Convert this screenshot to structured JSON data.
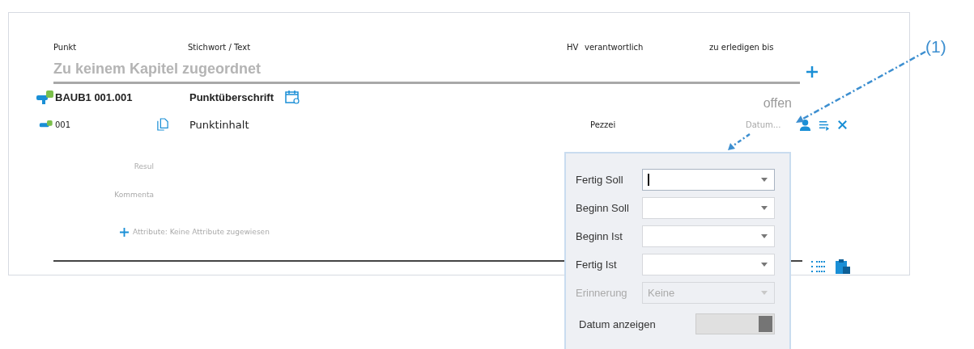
{
  "columns": [
    "Punkt",
    "Stichwort / Text",
    "HV",
    "verantwortlich",
    "zu erledigen bis"
  ],
  "chapter": "Zu keinem Kapitel zugeordnet",
  "point": {
    "number": "BAUB1 001.001",
    "heading": "Punktüberschrift",
    "status": "offen"
  },
  "subpoint": {
    "number": "001",
    "content": "Punktinhalt",
    "responsible": "Pezzei",
    "date": "Datum..."
  },
  "fields": [
    {
      "label": "Resul"
    },
    {
      "label": "Kommenta"
    }
  ],
  "attributes": "Attribute:  Keine Attribute zugewiesen",
  "date_popup": {
    "fields": [
      {
        "label": "Fertig Soll",
        "focused": true,
        "disabled": false
      },
      {
        "label": "Beginn Soll",
        "focused": false,
        "disabled": false
      },
      {
        "label": "Beginn Ist",
        "focused": false,
        "disabled": false
      },
      {
        "label": "Fertig Ist",
        "focused": false,
        "disabled": false
      },
      {
        "label": "Erinnerung",
        "value": "Keine",
        "focused": false,
        "disabled": true
      }
    ],
    "toggle": {
      "label": "Datum anzeigen",
      "on": true
    }
  },
  "annotation": "(1)"
}
